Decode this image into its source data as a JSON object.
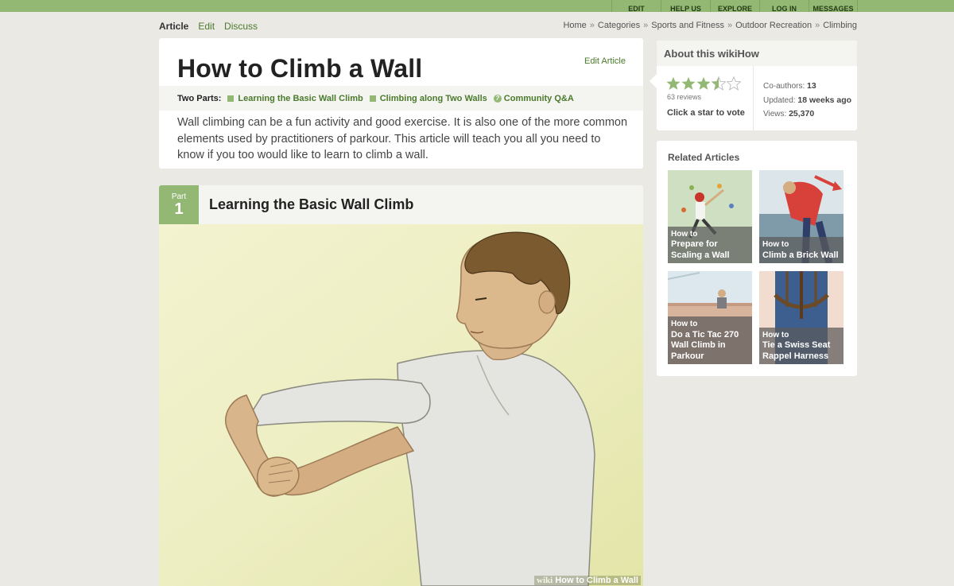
{
  "topnav": [
    "EDIT",
    "HELP US",
    "EXPLORE",
    "LOG IN",
    "MESSAGES"
  ],
  "page_tabs": {
    "article": "Article",
    "edit": "Edit",
    "discuss": "Discuss"
  },
  "breadcrumb": [
    "Home",
    "Categories",
    "Sports and Fitness",
    "Outdoor Recreation",
    "Climbing"
  ],
  "breadcrumb_sep": "»",
  "article": {
    "title": "How to Climb a Wall",
    "edit_label": "Edit Article",
    "parts_label": "Two Parts:",
    "parts": [
      "Learning the Basic Wall Climb",
      "Climbing along Two Walls"
    ],
    "community_qa": "Community Q&A",
    "intro": "Wall climbing can be a fun activity and good exercise. It is also one of the more common elements used by practitioners of parkour. This article will teach you all you need to know if you too would like to learn to climb a wall."
  },
  "section": {
    "part_word": "Part",
    "part_number": "1",
    "title": "Learning the Basic Wall Climb",
    "watermark_brand": "wiki",
    "watermark_title": "How to Climb a Wall"
  },
  "about": {
    "title": "About this wikiHow",
    "rating": 3.5,
    "rating_max": 5,
    "reviews": "63 reviews",
    "vote": "Click a star to vote",
    "coauthors_label": "Co-authors:",
    "coauthors": "13",
    "updated_label": "Updated:",
    "updated": "18 weeks ago",
    "views_label": "Views:",
    "views": "25,370"
  },
  "related": {
    "title": "Related Articles",
    "how_to": "How to",
    "items": [
      {
        "title": "Prepare for Scaling a Wall"
      },
      {
        "title": "Climb a Brick Wall"
      },
      {
        "title": "Do a Tic Tac 270 Wall Climb in Parkour"
      },
      {
        "title": "Tie a Swiss Seat Rappel Harness"
      }
    ]
  },
  "colors": {
    "brand_green": "#93b874",
    "link_green": "#4a7a2c",
    "page_bg": "#eae9e4"
  }
}
